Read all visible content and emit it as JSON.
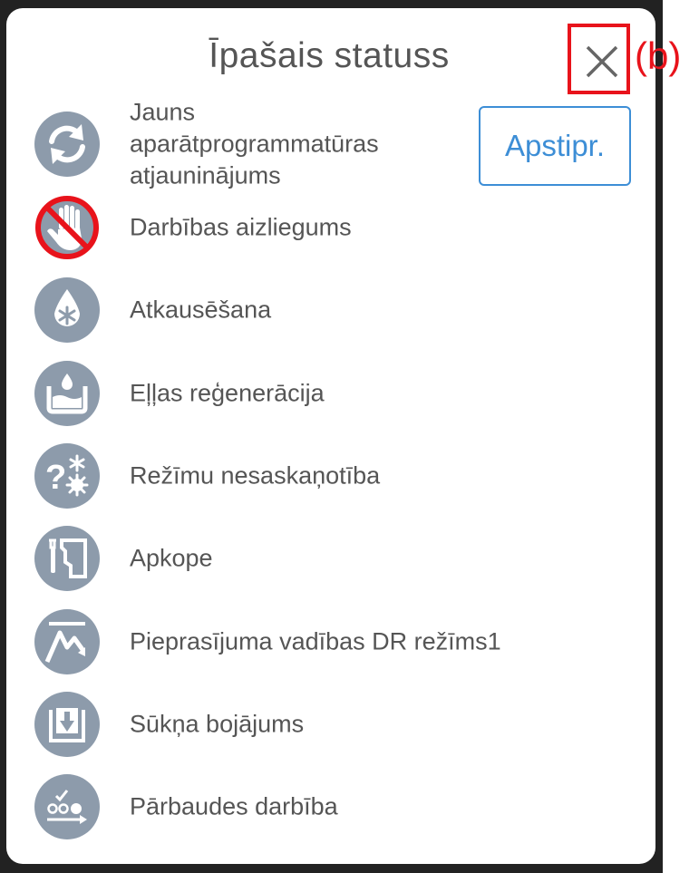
{
  "dialog": {
    "title": "Īpašais statuss",
    "annotation": "(b)",
    "confirm_label": "Apstipr."
  },
  "items": [
    {
      "label": "Jauns aparātprogrammatūras atjauninājums",
      "icon": "refresh-icon"
    },
    {
      "label": "Darbības aizliegums",
      "icon": "operation-prohibited-icon"
    },
    {
      "label": "Atkausēšana",
      "icon": "defrost-icon"
    },
    {
      "label": "Eļļas reģenerācija",
      "icon": "oil-recovery-icon"
    },
    {
      "label": "Režīmu nesaskaņotība",
      "icon": "mode-mismatch-icon"
    },
    {
      "label": "Apkope",
      "icon": "maintenance-icon"
    },
    {
      "label": "Pieprasījuma vadības DR režīms1",
      "icon": "demand-response-icon"
    },
    {
      "label": "Sūkņa bojājums",
      "icon": "pump-failure-icon"
    },
    {
      "label": "Pārbaudes darbība",
      "icon": "test-run-icon"
    }
  ],
  "colors": {
    "icon_bg": "#8d9bab",
    "accent": "#3d8ed6",
    "annotation": "#e8131b",
    "prohibited": "#e8131b"
  }
}
